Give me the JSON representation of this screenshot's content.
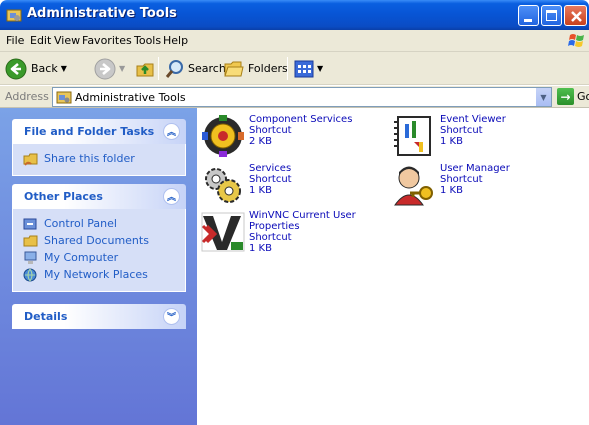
{
  "window": {
    "title": "Administrative Tools"
  },
  "menu": [
    "File",
    "Edit",
    "View",
    "Favorites",
    "Tools",
    "Help"
  ],
  "toolbar": {
    "back": "Back",
    "search": "Search",
    "folders": "Folders"
  },
  "address": {
    "label": "Address",
    "value": "Administrative Tools",
    "go": "Go"
  },
  "tasks": {
    "title": "File and Folder Tasks",
    "items": [
      {
        "label": "Share this folder"
      }
    ]
  },
  "places": {
    "title": "Other Places",
    "items": [
      {
        "label": "Control Panel"
      },
      {
        "label": "Shared Documents"
      },
      {
        "label": "My Computer"
      },
      {
        "label": "My Network Places"
      }
    ]
  },
  "details": {
    "title": "Details"
  },
  "files": [
    {
      "name": "Component Services",
      "type": "Shortcut",
      "size": "2 KB"
    },
    {
      "name": "Event Viewer",
      "type": "Shortcut",
      "size": "1 KB"
    },
    {
      "name": "Services",
      "type": "Shortcut",
      "size": "1 KB"
    },
    {
      "name": "User Manager",
      "type": "Shortcut",
      "size": "1 KB"
    },
    {
      "name": "WinVNC Current User Properties",
      "type": "Shortcut",
      "size": "1 KB"
    }
  ],
  "colors": {
    "titlebar": "#0854d4",
    "taskpane": "#7ba2e7",
    "link": "#215dc6"
  }
}
